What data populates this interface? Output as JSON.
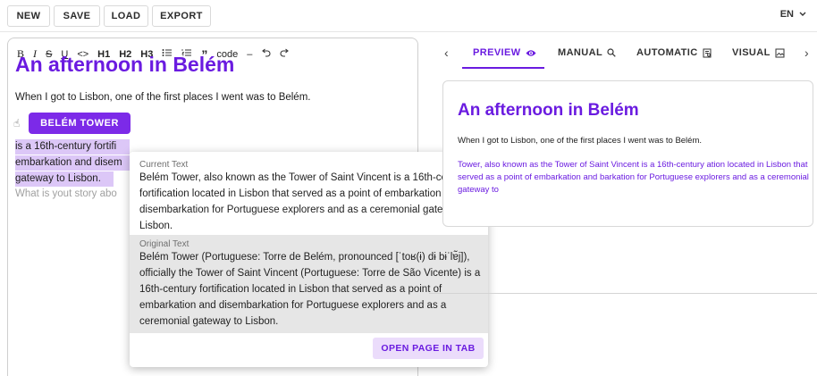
{
  "toolbar": {
    "buttons": [
      "NEW",
      "SAVE",
      "LOAD",
      "EXPORT"
    ],
    "language": "EN"
  },
  "editor": {
    "format_buttons": [
      "B",
      "I",
      "S",
      "U",
      "<>",
      "H1",
      "H2",
      "H3",
      "bulleted-list",
      "numbered-list",
      "quote",
      "code",
      "divider",
      "undo",
      "redo"
    ],
    "title": "An afternoon in Belém",
    "paragraph": "When I got to Lisbon, one of the first places I went was to Belém.",
    "highlight_lines": [
      "is a 16th-century fortifi",
      "embarkation and disem",
      "gateway to Lisbon."
    ],
    "placeholder": "What is yout story abo",
    "tag_label": "BELÉM TOWER"
  },
  "popup": {
    "current_label": "Current Text",
    "current_text": "Belém Tower, also known as the Tower of Saint Vincent is a 16th-century fortification located in Lisbon that served as a point of embarkation and disembarkation for Portuguese explorers and as a ceremonial gateway to Lisbon.",
    "original_label": "Original Text",
    "original_text": "Belém Tower (Portuguese: Torre de Belém, pronounced [ˈtoʁ(ɨ) dɨ bɨˈlɐ̃j]), officially the Tower of Saint Vincent (Portuguese: Torre de São Vicente) is a 16th-century fortification located in Lisbon that served as a point of embarkation and disembarkation for Portuguese explorers and as a ceremonial gateway to Lisbon.",
    "open_button": "OPEN PAGE IN TAB"
  },
  "tabs": [
    "PREVIEW",
    "MANUAL",
    "AUTOMATIC",
    "VISUAL"
  ],
  "preview": {
    "title": "An afternoon in Belém",
    "paragraph": "When I got to Lisbon, one of the first places I went was to Belém.",
    "highlight_text": "Tower, also known as the Tower of Saint Vincent  is a 16th-century ation located in Lisbon that served as a point of embarkation and barkation for Portuguese explorers and as a ceremonial gateway to"
  },
  "colors": {
    "accent": "#6a1be0",
    "tag_bg": "#7c2ae8",
    "highlight": "#dcc7f7",
    "button_bg": "#ebdcfb"
  }
}
